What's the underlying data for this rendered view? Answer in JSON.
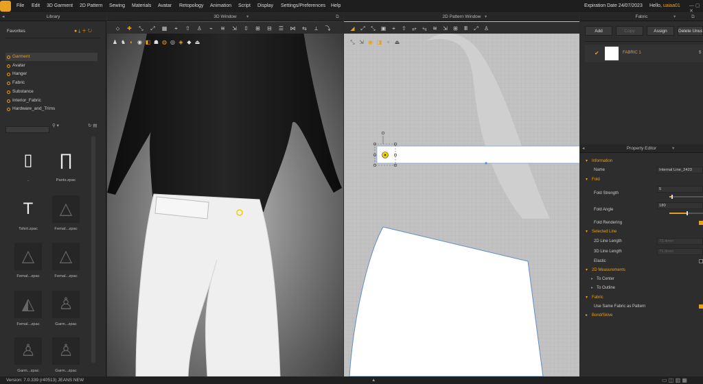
{
  "menubar": {
    "items": [
      "File",
      "Edit",
      "3D Garment",
      "2D Pattern",
      "Sewing",
      "Materials",
      "Avatar",
      "Retopology",
      "Animation",
      "Script",
      "Display",
      "Settings/Preferences",
      "Help"
    ],
    "expiry": "Expiration Date 24/07/2023",
    "hello_prefix": "Hello, ",
    "username": "uaiaa01",
    "accent": "#e8a020"
  },
  "library": {
    "title": "Library",
    "favorites_label": "Favorites",
    "items": [
      {
        "label": "Garment",
        "selected": true
      },
      {
        "label": "Avatar"
      },
      {
        "label": "Hanger"
      },
      {
        "label": "Fabric"
      },
      {
        "label": "Substance"
      },
      {
        "label": "Interior_Fabric"
      },
      {
        "label": "Hardware_and_Trims"
      }
    ],
    "thumbs": [
      {
        "label": "..",
        "icon": "folder-icon"
      },
      {
        "label": "Pants.zpac",
        "icon": "pants-icon"
      },
      {
        "label": "Tshirt.zpac",
        "icon": "tshirt-icon"
      },
      {
        "label": "Femal...zpac",
        "icon": "dress-icon"
      },
      {
        "label": "Femal...zpac",
        "icon": "dress-icon"
      },
      {
        "label": "Femal...zpac",
        "icon": "dress-icon"
      },
      {
        "label": "Femal...zpac",
        "icon": "skirt-icon"
      },
      {
        "label": "Garm...zpac",
        "icon": "outfit-icon"
      },
      {
        "label": "Garm...zpac",
        "icon": "outfit-icon"
      },
      {
        "label": "Garm...zpac",
        "icon": "outfit-icon"
      }
    ]
  },
  "window3d": {
    "title": "3D Window"
  },
  "window2d": {
    "title": "2D Pattern Window"
  },
  "fabric_panel": {
    "title": "Fabric",
    "buttons": {
      "add": "Add",
      "copy": "Copy",
      "assign": "Assign",
      "delete": "Delete Unus"
    },
    "fabric_name": "FABRIC 1",
    "fabric_extra": "$"
  },
  "property_editor": {
    "title": "Property Editor",
    "information": "Information",
    "name_label": "Name",
    "name_value": "Internal Line_2423",
    "fold": "Fold",
    "fold_strength_label": "Fold Strength",
    "fold_strength_value": "5",
    "fold_angle_label": "Fold Angle",
    "fold_angle_value": "180",
    "fold_rendering_label": "Fold Rendering",
    "selected_line": "Selected Line",
    "line2d_label": "2D Line Length",
    "line2d_value": "73.4mm",
    "line3d_label": "3D Line Length",
    "line3d_value": "71.9mm",
    "elastic_label": "Elastic",
    "measurements": "2D Measurements",
    "to_center": "To Center",
    "to_outline": "To Outline",
    "fabric": "Fabric",
    "same_fabric_label": "Use Same Fabric as Pattern",
    "bond": "Bond/Skive"
  },
  "status": {
    "version": "Version:  7.0.339 (r40513)   JEANS NEW"
  }
}
